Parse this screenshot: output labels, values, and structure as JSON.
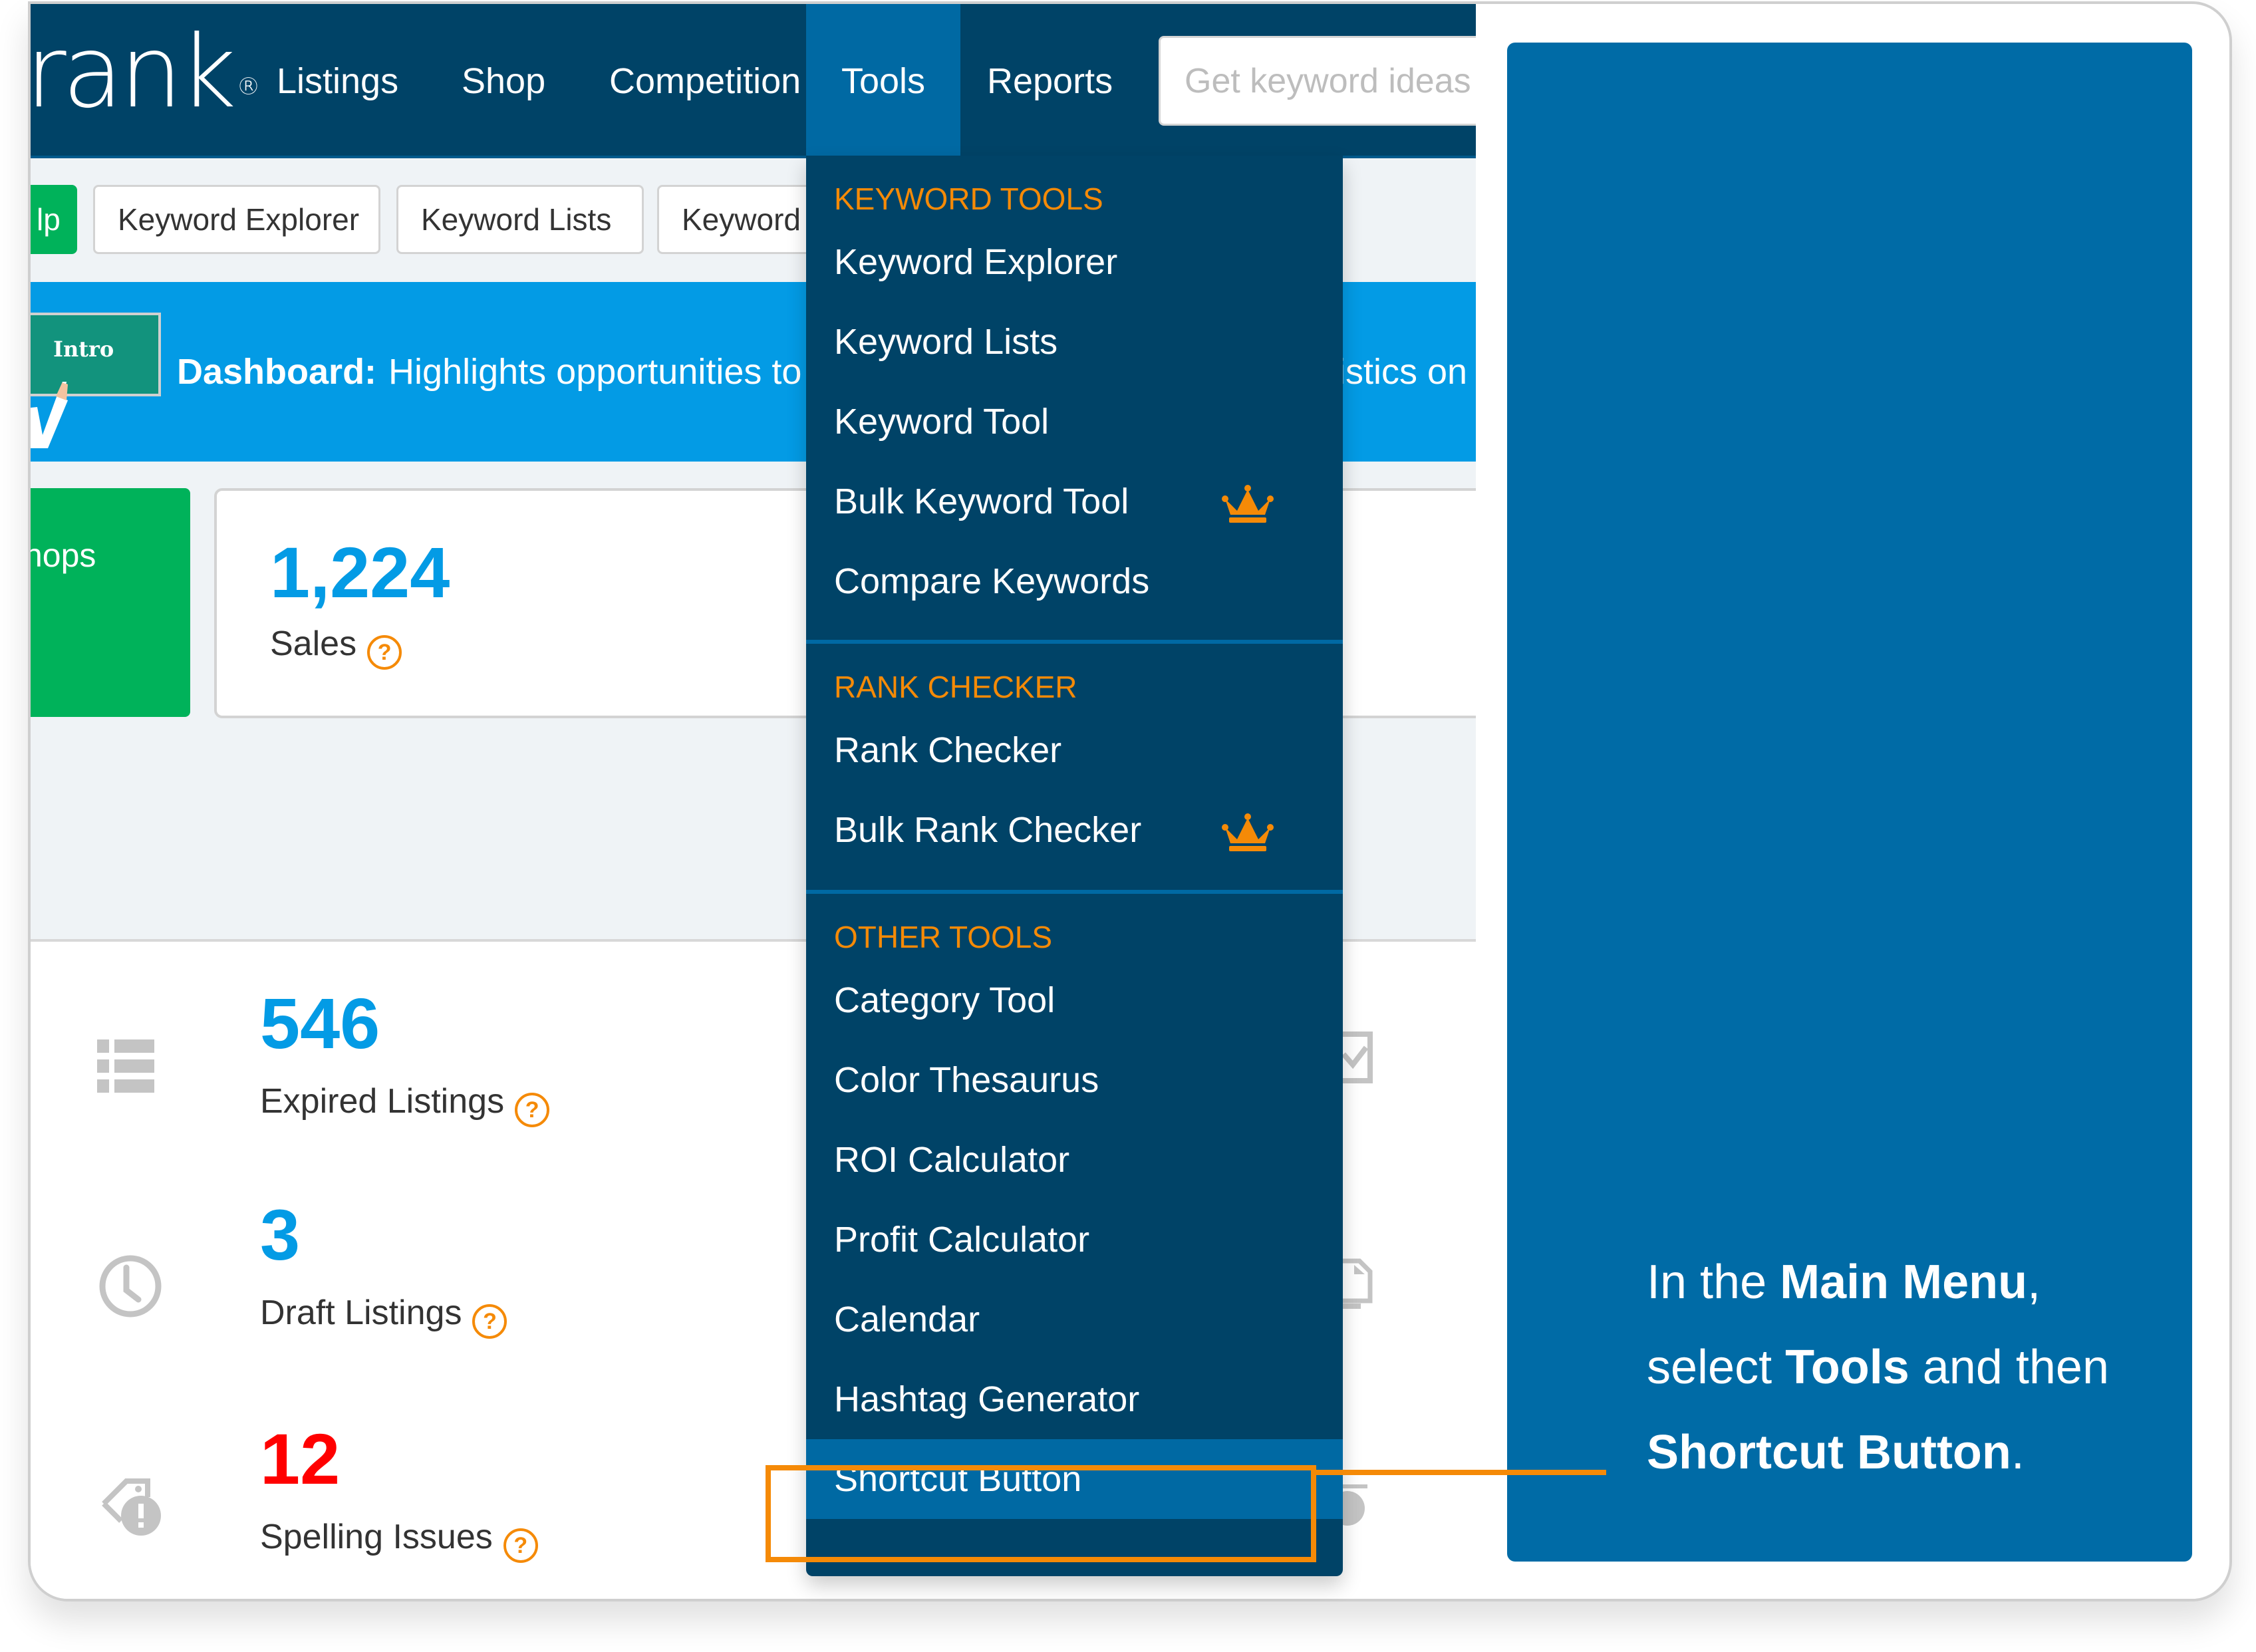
{
  "header": {
    "logo_text": "rank",
    "logo_mark": "®",
    "nav": [
      {
        "label": "Listings",
        "active": false
      },
      {
        "label": "Shop",
        "active": false
      },
      {
        "label": "Competition",
        "active": false
      },
      {
        "label": "Tools",
        "active": true
      },
      {
        "label": "Reports",
        "active": false
      }
    ],
    "search_placeholder": "Get keyword ideas"
  },
  "subnav": {
    "buttons": [
      {
        "label": "lp",
        "style": "green"
      },
      {
        "label": "Keyword Explorer"
      },
      {
        "label": "Keyword Lists"
      },
      {
        "label": "Keyword"
      }
    ]
  },
  "banner": {
    "illustration_label": "Intro",
    "title": "Dashboard:",
    "text": "Highlights opportunities to",
    "text_tail": "istics on"
  },
  "stats_top": {
    "green_card_label": "hops",
    "sales": {
      "value": "1,224",
      "label": "Sales",
      "help": "?"
    }
  },
  "stats": [
    {
      "value": "546",
      "label": "Expired Listings",
      "icon": "list-icon",
      "color": "#039be5",
      "help": "?"
    },
    {
      "value": "3",
      "label": "Draft Listings",
      "icon": "clock-icon",
      "color": "#039be5",
      "help": "?"
    },
    {
      "value": "12",
      "label": "Spelling Issues",
      "icon": "tag-alert-icon",
      "color": "#ff0000",
      "help": "?"
    }
  ],
  "dropdown": {
    "sections": [
      {
        "header": "KEYWORD TOOLS",
        "items": [
          {
            "label": "Keyword Explorer",
            "premium": false
          },
          {
            "label": "Keyword Lists",
            "premium": false
          },
          {
            "label": "Keyword Tool",
            "premium": false
          },
          {
            "label": "Bulk Keyword Tool",
            "premium": true
          },
          {
            "label": "Compare Keywords",
            "premium": false
          }
        ]
      },
      {
        "header": "RANK CHECKER",
        "items": [
          {
            "label": "Rank Checker",
            "premium": false
          },
          {
            "label": "Bulk Rank Checker",
            "premium": true
          }
        ]
      },
      {
        "header": "OTHER TOOLS",
        "items": [
          {
            "label": "Category Tool",
            "premium": false
          },
          {
            "label": "Color Thesaurus",
            "premium": false
          },
          {
            "label": "ROI Calculator",
            "premium": false
          },
          {
            "label": "Profit Calculator",
            "premium": false
          },
          {
            "label": "Calendar",
            "premium": false
          },
          {
            "label": "Hashtag Generator",
            "premium": false
          },
          {
            "label": "Shortcut Button",
            "premium": false,
            "highlighted": true
          }
        ]
      }
    ]
  },
  "instruction": {
    "line1_pre": "In the ",
    "line1_bold": "Main Menu",
    "line1_post": ",",
    "line2_pre": "select ",
    "line2_bold": "Tools",
    "line2_post": " and then",
    "line3_bold": "Shortcut Button",
    "line3_post": "."
  },
  "colors": {
    "nav_bg": "#004367",
    "active_tab": "#0069a3",
    "banner": "#039be5",
    "accent_orange": "#f58a07",
    "stat_blue": "#039be5",
    "stat_red": "#ff0000",
    "green": "#00b25a",
    "tip_panel": "#006ba6"
  }
}
